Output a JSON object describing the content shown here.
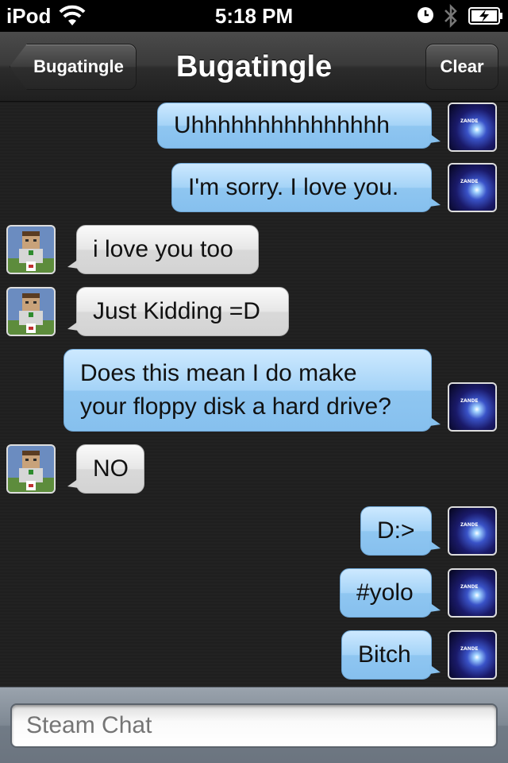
{
  "status_bar": {
    "carrier": "iPod",
    "time": "5:18 PM"
  },
  "nav": {
    "back_label": "Bugatingle",
    "title": "Bugatingle",
    "clear_label": "Clear"
  },
  "messages": [
    {
      "text": "Uhhhhhhhhhhhhhhh",
      "side": "out"
    },
    {
      "text": "I'm sorry. I love you.",
      "side": "out"
    },
    {
      "text": "i love you too",
      "side": "in"
    },
    {
      "text": "Just Kidding =D",
      "side": "in"
    },
    {
      "text_line1": "Does this mean I do make",
      "text_line2": "your floppy disk a hard drive?",
      "side": "out"
    },
    {
      "text": "NO",
      "side": "in"
    },
    {
      "text": "D:>",
      "side": "out"
    },
    {
      "text": "#yolo",
      "side": "out"
    },
    {
      "text": "Bitch",
      "side": "out"
    }
  ],
  "input": {
    "placeholder": "Steam Chat"
  }
}
